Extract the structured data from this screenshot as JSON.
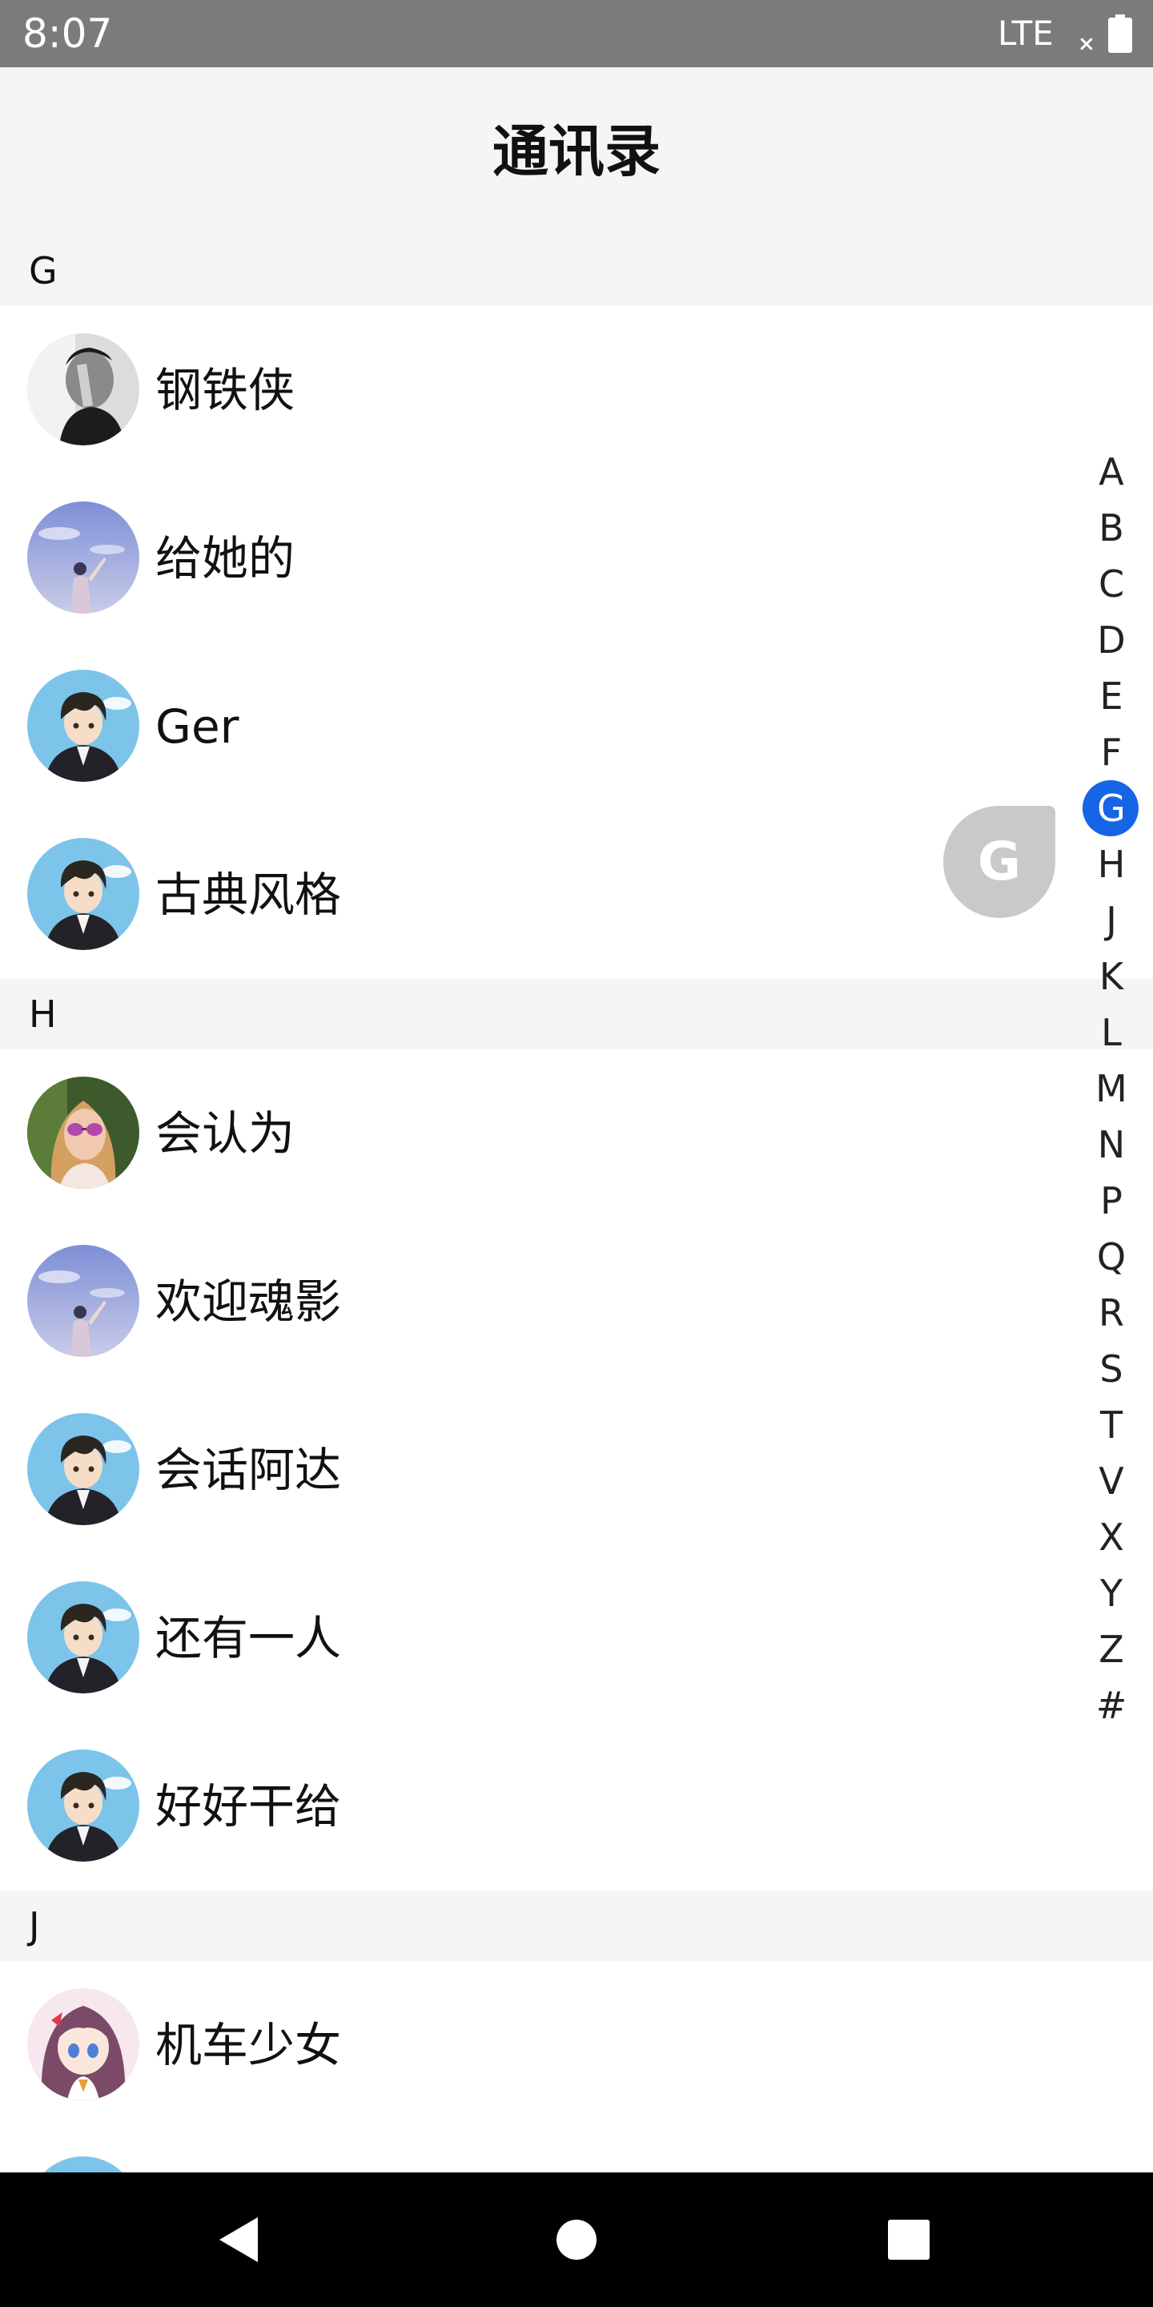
{
  "status_bar": {
    "time": "8:07",
    "network": "LTE",
    "signal_mark": "×"
  },
  "header": {
    "title": "通讯录"
  },
  "sections": [
    {
      "letter": "G",
      "contacts": [
        {
          "name": "钢铁侠",
          "avatar": "bw-man-avatar"
        },
        {
          "name": "给她的",
          "avatar": "sky-person-avatar"
        },
        {
          "name": "Ger",
          "avatar": "anime-boy-avatar"
        },
        {
          "name": "古典风格",
          "avatar": "anime-boy-avatar"
        }
      ]
    },
    {
      "letter": "H",
      "contacts": [
        {
          "name": "会认为",
          "avatar": "sunglasses-woman-avatar"
        },
        {
          "name": "欢迎魂影",
          "avatar": "sky-person-avatar"
        },
        {
          "name": "会话阿达",
          "avatar": "anime-boy-avatar"
        },
        {
          "name": "还有一人",
          "avatar": "anime-boy-avatar"
        },
        {
          "name": "好好干给",
          "avatar": "anime-boy-avatar"
        }
      ]
    },
    {
      "letter": "J",
      "contacts": [
        {
          "name": "机车少女",
          "avatar": "anime-girl-avatar"
        }
      ]
    }
  ],
  "index_bar": {
    "letters": [
      "A",
      "B",
      "C",
      "D",
      "E",
      "F",
      "G",
      "H",
      "J",
      "K",
      "L",
      "M",
      "N",
      "P",
      "Q",
      "R",
      "S",
      "T",
      "V",
      "X",
      "Y",
      "Z",
      "#"
    ],
    "active": "G",
    "active_color": "#1565e6"
  },
  "bubble": {
    "letter": "G"
  },
  "nav_bar": {
    "buttons": [
      "back-icon",
      "home-icon",
      "recents-icon"
    ]
  },
  "colors": {
    "status_bar": "#7b7b7b",
    "header_bg": "#f5f5f5",
    "section_bg": "#f5f5f5",
    "nav_bar": "#000000",
    "bubble": "#c9c9c9"
  }
}
